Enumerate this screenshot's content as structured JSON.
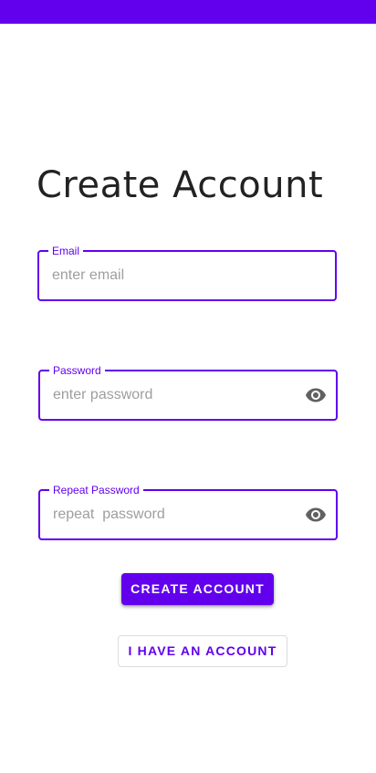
{
  "status_bar": {
    "color": "#6200ee"
  },
  "page": {
    "title": "Create Account"
  },
  "form": {
    "email": {
      "label": "Email",
      "placeholder": "enter email",
      "value": ""
    },
    "password": {
      "label": "Password",
      "placeholder": "enter password",
      "value": "",
      "toggle_icon": "eye-icon"
    },
    "repeat_password": {
      "label": "Repeat Password",
      "placeholder": "repeat  password",
      "value": "",
      "toggle_icon": "eye-icon"
    }
  },
  "actions": {
    "create_account_label": "CREATE ACCOUNT",
    "have_account_label": "I HAVE AN ACCOUNT"
  },
  "colors": {
    "accent": "#6200ee",
    "text": "#222222",
    "placeholder": "#9e9e9e",
    "icon": "#616161"
  }
}
